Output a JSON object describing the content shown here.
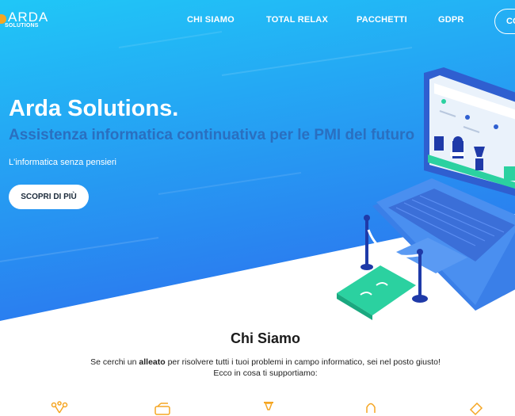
{
  "brand": {
    "name": "ARDA",
    "sub": "SOLUTIONS"
  },
  "nav": {
    "items": [
      {
        "label": "CHI SIAMO"
      },
      {
        "label": "TOTAL RELAX"
      },
      {
        "label": "PACCHETTI"
      },
      {
        "label": "GDPR"
      }
    ],
    "contact_label": "CO"
  },
  "hero": {
    "title": "Arda Solutions.",
    "subtitle": "Assistenza informatica continuativa per le PMI del futuro",
    "tagline": "L'informatica senza pensieri",
    "cta_label": "SCOPRI DI PIÙ"
  },
  "about": {
    "title": "Chi Siamo",
    "text_before": "Se cerchi un ",
    "text_bold": "alleato",
    "text_after": " per risolvere tutti i tuoi problemi in campo informatico, sei nel posto giusto!",
    "text_line2": "Ecco in cosa ti supportiamo:"
  },
  "colors": {
    "accent": "#f5a623",
    "hero_top": "#1ec8f5",
    "hero_bottom": "#2a7cf0"
  },
  "icons": [
    "network-icon",
    "server-icon",
    "hourglass-icon",
    "lock-icon",
    "hammer-icon"
  ]
}
